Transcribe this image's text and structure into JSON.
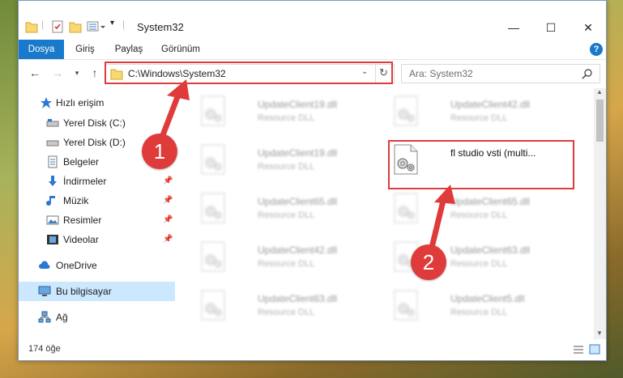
{
  "window": {
    "title": "System32"
  },
  "window_controls": {
    "minimize": "—",
    "maximize": "☐",
    "close": "✕"
  },
  "ribbon": {
    "tabs": [
      "Dosya",
      "Giriş",
      "Paylaş",
      "Görünüm"
    ],
    "help": "?"
  },
  "address": {
    "path": "C:\\Windows\\System32"
  },
  "search": {
    "placeholder": "Ara: System32"
  },
  "sidebar": {
    "items": [
      {
        "label": "Hızlı erişim",
        "icon": "star-icon"
      },
      {
        "label": "Yerel Disk (C:)",
        "icon": "drive-icon"
      },
      {
        "label": "Yerel Disk (D:)",
        "icon": "drive-icon"
      },
      {
        "label": "Belgeler",
        "icon": "documents-icon"
      },
      {
        "label": "İndirmeler",
        "icon": "download-icon"
      },
      {
        "label": "Müzik",
        "icon": "music-icon"
      },
      {
        "label": "Resimler",
        "icon": "pictures-icon"
      },
      {
        "label": "Videolar",
        "icon": "videos-icon"
      },
      {
        "label": "OneDrive",
        "icon": "cloud-icon"
      },
      {
        "label": "Bu bilgisayar",
        "icon": "computer-icon"
      },
      {
        "label": "Ağ",
        "icon": "network-icon"
      }
    ]
  },
  "files": [
    {
      "name": "UpdateClient19.dll",
      "type": "Resource DLL"
    },
    {
      "name": "UpdateClient42.dll",
      "type": "Resource DLL"
    },
    {
      "name": "UpdateClient19.dll",
      "type": "Resource DLL"
    },
    {
      "name": "fl studio vsti (multi...",
      "type": ""
    },
    {
      "name": "UpdateClient65.dll",
      "type": "Resource DLL"
    },
    {
      "name": "UpdateClient65.dll",
      "type": "Resource DLL"
    },
    {
      "name": "UpdateClient42.dll",
      "type": "Resource DLL"
    },
    {
      "name": "UpdateClient63.dll",
      "type": "Resource DLL"
    },
    {
      "name": "UpdateClient63.dll",
      "type": "Resource DLL"
    },
    {
      "name": "UpdateClient5.dll",
      "type": "Resource DLL"
    }
  ],
  "status": {
    "count": "174 öğe"
  },
  "callouts": [
    "1",
    "2"
  ],
  "colors": {
    "accent": "#1979ca",
    "highlight": "#e03b3b",
    "selection": "#cce8ff"
  }
}
